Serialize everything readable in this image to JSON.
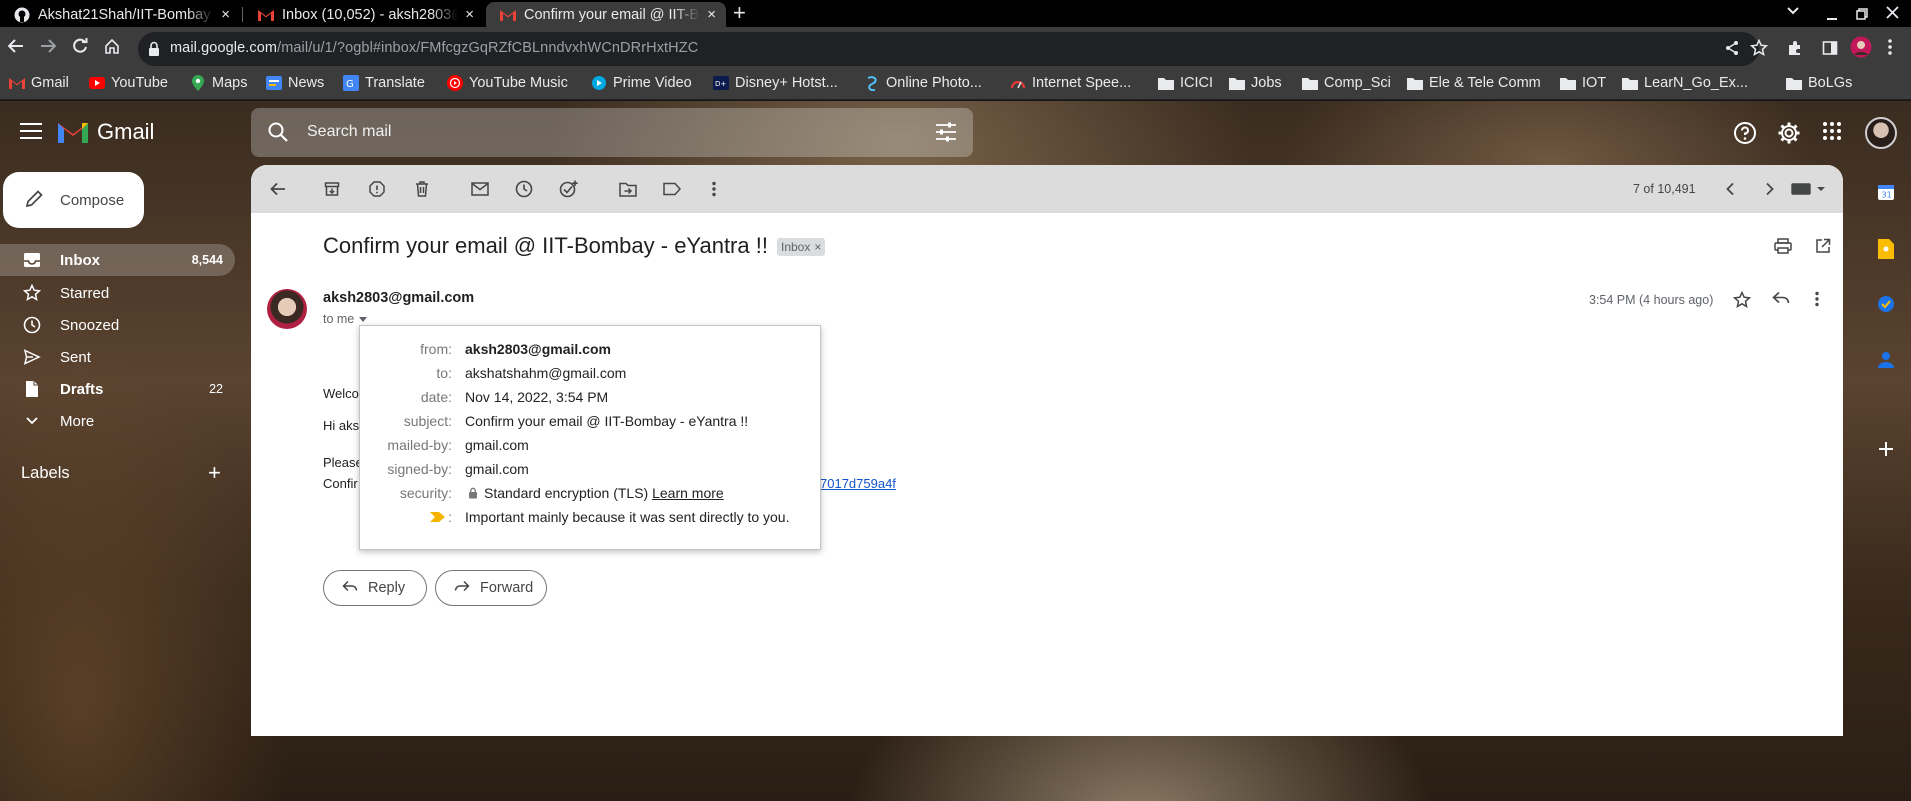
{
  "browser": {
    "tabs": [
      {
        "title": "Akshat21Shah/IIT-Bombay",
        "active": false,
        "icon": "github-icon"
      },
      {
        "title": "Inbox (10,052) - aksh2803@",
        "active": false,
        "icon": "gmail-icon"
      },
      {
        "title": "Confirm your email @ IIT-B",
        "active": true,
        "icon": "gmail-icon"
      }
    ],
    "close_glyph": "×",
    "newtab_glyph": "+",
    "url_main": "mail.google.com",
    "url_rest": "/mail/u/1/?ogbl#inbox/FMfcgzGqRZfCBLnndvxhWCnDRrHxtHZC",
    "bookmarks": [
      {
        "label": "Gmail",
        "icon": "gmail-icon"
      },
      {
        "label": "YouTube",
        "icon": "youtube-icon"
      },
      {
        "label": "Maps",
        "icon": "maps-icon"
      },
      {
        "label": "News",
        "icon": "news-icon"
      },
      {
        "label": "Translate",
        "icon": "translate-icon"
      },
      {
        "label": "YouTube Music",
        "icon": "youtube-music-icon"
      },
      {
        "label": "Prime Video",
        "icon": "prime-video-icon"
      },
      {
        "label": "Disney+ Hotst...",
        "icon": "hotstar-icon"
      },
      {
        "label": "Online Photo...",
        "icon": "photo-icon"
      },
      {
        "label": "Internet Spee...",
        "icon": "speedtest-icon"
      },
      {
        "label": "ICICI",
        "icon": "folder-icon"
      },
      {
        "label": "Jobs",
        "icon": "folder-icon"
      },
      {
        "label": "Comp_Sci",
        "icon": "folder-icon"
      },
      {
        "label": "Ele & Tele Comm",
        "icon": "folder-icon"
      },
      {
        "label": "IOT",
        "icon": "folder-icon"
      },
      {
        "label": "LearN_Go_Ex...",
        "icon": "folder-icon"
      },
      {
        "label": "BoLGs",
        "icon": "folder-icon"
      }
    ]
  },
  "gmail": {
    "brand": "Gmail",
    "search_placeholder": "Search mail",
    "compose_label": "Compose",
    "nav": [
      {
        "label": "Inbox",
        "count": "8,544",
        "active": true,
        "icon": "inbox-icon"
      },
      {
        "label": "Starred",
        "count": "",
        "active": false,
        "icon": "star-icon"
      },
      {
        "label": "Snoozed",
        "count": "",
        "active": false,
        "icon": "clock-icon"
      },
      {
        "label": "Sent",
        "count": "",
        "active": false,
        "icon": "send-icon"
      },
      {
        "label": "Drafts",
        "count": "22",
        "active": false,
        "icon": "draft-icon",
        "bold": true
      },
      {
        "label": "More",
        "count": "",
        "active": false,
        "icon": "chevron-down-icon"
      }
    ],
    "labels_heading": "Labels",
    "labels_add": "+",
    "pager": "7 of 10,491",
    "message": {
      "subject": "Confirm your email @ IIT-Bombay - eYantra !!",
      "label_chip": "Inbox",
      "label_chip_close": "×",
      "sender": "aksh2803@gmail.com",
      "to_line": "to me",
      "time": "3:54 PM (4 hours ago)",
      "body": {
        "line1": "Welco",
        "line2": "Hi aks",
        "line3": "Please",
        "line4": "Confir",
        "link_tail": "7017d759a4f"
      },
      "details": {
        "from_k": "from:",
        "from_v": "aksh2803@gmail.com",
        "to_k": "to:",
        "to_v": "akshatshahm@gmail.com",
        "date_k": "date:",
        "date_v": "Nov 14, 2022, 3:54 PM",
        "subject_k": "subject:",
        "subject_v": "Confirm your email @ IIT-Bombay - eYantra !!",
        "mailed_k": "mailed-by:",
        "mailed_v": "gmail.com",
        "signed_k": "signed-by:",
        "signed_v": "gmail.com",
        "security_k": "security:",
        "security_v": "Standard encryption (TLS)",
        "security_link": "Learn more",
        "important_k": ":",
        "important_v": "Important mainly because it was sent directly to you."
      },
      "reply_label": "Reply",
      "forward_label": "Forward"
    }
  },
  "colors": {
    "chrome_dark": "#3c3c3c",
    "tab_strip": "#000000",
    "gmail_red": "#ea4335",
    "link": "#1155cc",
    "important_yellow": "#f4b400"
  }
}
